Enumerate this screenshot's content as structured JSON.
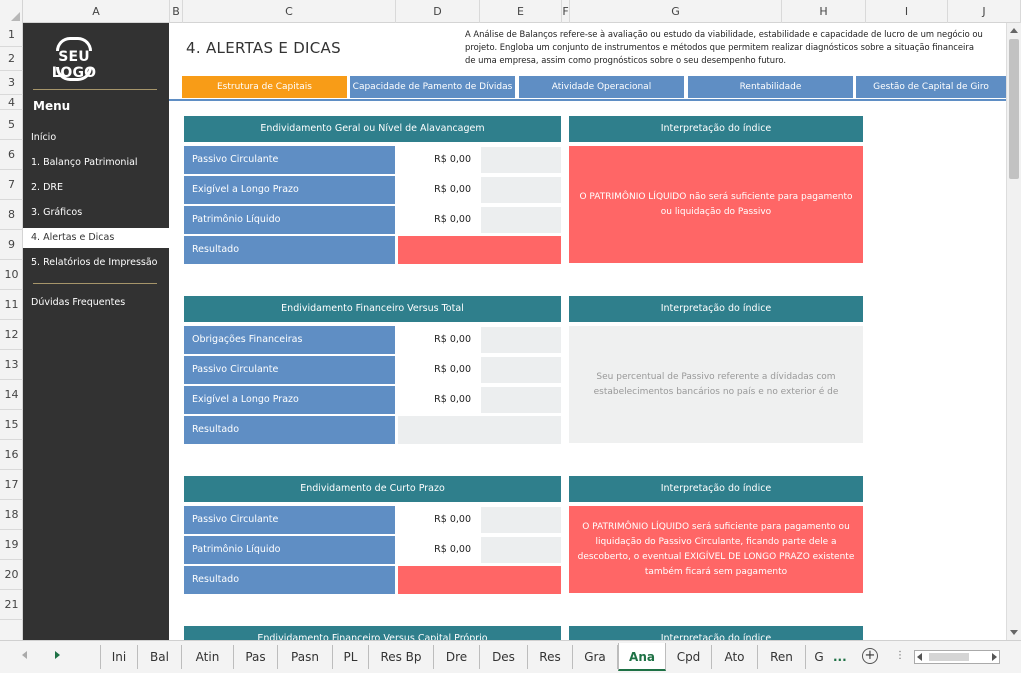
{
  "columns": [
    "A",
    "B",
    "C",
    "D",
    "E",
    "F",
    "G",
    "H",
    "I",
    "J"
  ],
  "rows": [
    "1",
    "2",
    "3",
    "4",
    "5",
    "6",
    "7",
    "8",
    "9",
    "10",
    "11",
    "12",
    "13",
    "14",
    "15",
    "16",
    "17",
    "18",
    "19",
    "20",
    "21"
  ],
  "logo": "SEU LOGO",
  "sidebar": {
    "menu_title": "Menu",
    "items": [
      {
        "label": "Início"
      },
      {
        "label": "1. Balanço Patrimonial"
      },
      {
        "label": "2. DRE"
      },
      {
        "label": "3. Gráficos"
      },
      {
        "label": "4. Alertas e Dicas"
      },
      {
        "label": "5. Relatórios de Impressão"
      },
      {
        "label": "Dúvidas Frequentes"
      }
    ]
  },
  "header": {
    "title": "4. ALERTAS E DICAS",
    "description_lines": [
      "A Análise de Balanços refere-se à avaliação ou estudo da viabilidade, estabilidade e capacidade de lucro de um negócio ou",
      "projeto. Engloba um conjunto de instrumentos e métodos que permitem realizar diagnósticos sobre a situação financeira",
      "de uma empresa, assim como prognósticos sobre o seu desempenho futuro."
    ]
  },
  "tabs": [
    {
      "label": "Estrutura de Capitais"
    },
    {
      "label": "Capacidade de Pamento de Dívidas"
    },
    {
      "label": "Atividade Operacional"
    },
    {
      "label": "Rentabilidade"
    },
    {
      "label": "Gestão de Capital de Giro"
    }
  ],
  "blocks": [
    {
      "title": "Endividamento Geral ou Nível de Alavancagem",
      "rows": [
        {
          "label": "Passivo Circulante",
          "value": "R$ 0,00"
        },
        {
          "label": "Exigível a Longo Prazo",
          "value": "R$ 0,00"
        },
        {
          "label": "Patrimônio Líquido",
          "value": "R$ 0,00"
        }
      ],
      "result_label": "Resultado",
      "interp_title": "Interpretação do índice",
      "interp_text": "O PATRIMÔNIO LÍQUIDO não será suficiente para pagamento ou liquidação do Passivo"
    },
    {
      "title": "Endividamento Financeiro Versus Total",
      "rows": [
        {
          "label": "Obrigações Financeiras",
          "value": "R$ 0,00"
        },
        {
          "label": "Passivo Circulante",
          "value": "R$ 0,00"
        },
        {
          "label": "Exigível a Longo Prazo",
          "value": "R$ 0,00"
        }
      ],
      "result_label": "Resultado",
      "interp_title": "Interpretação do índice",
      "interp_text": "Seu percentual de Passivo referente a dívidadas com estabelecimentos bancários no país e no exterior é de"
    },
    {
      "title": "Endividamento de Curto Prazo",
      "rows": [
        {
          "label": "Passivo Circulante",
          "value": "R$ 0,00"
        },
        {
          "label": "Patrimônio Líquido",
          "value": "R$ 0,00"
        }
      ],
      "result_label": "Resultado",
      "interp_title": "Interpretação do índice",
      "interp_text": "O PATRIMÔNIO LÍQUIDO será suficiente para pagamento ou liquidação do Passivo Circulante, ficando parte dele a descoberto, o eventual EXIGÍVEL DE LONGO PRAZO existente também ficará sem pagamento"
    },
    {
      "title": "Endividamento Financeiro Versus Capital Próprio",
      "interp_title": "Interpretação do índice"
    }
  ],
  "colors": {
    "sidebar": "#323232",
    "block_title": "#2f7f8c",
    "row_label": "#5f8ec4",
    "tab_active": "#f89c17",
    "result_red": "#ff6666",
    "grey_cell": "#eceeef"
  },
  "sheets": [
    "Ini",
    "Bal",
    "Atin",
    "Pas",
    "Pasn",
    "PL",
    "Res Bp",
    "Dre",
    "Des",
    "Res",
    "Gra",
    "Ana",
    "Cpd",
    "Ato",
    "Ren",
    "G"
  ],
  "sheets_active": "Ana",
  "sheets_more": "...",
  "add_sheet": "+",
  "hscroll_dots": "⋮"
}
